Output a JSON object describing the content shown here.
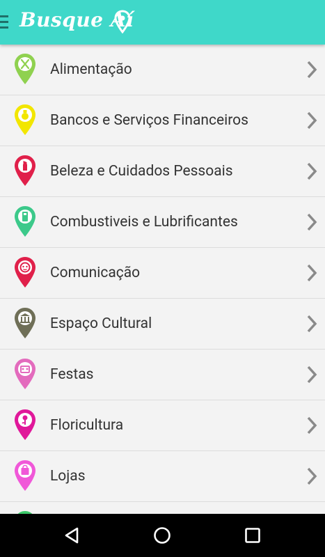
{
  "app_bar": {
    "title": "Busque Aí",
    "icons": [
      "menu-icon",
      "map-pin-icon"
    ],
    "color": "#3fd8c9"
  },
  "categories": [
    {
      "label": "Alimentação",
      "icon": "fork-knife-icon",
      "color": "#8fd14f"
    },
    {
      "label": "Bancos e Serviços Financeiros",
      "icon": "money-bag-icon",
      "color": "#f2e600"
    },
    {
      "label": "Beleza e Cuidados Pessoais",
      "icon": "lipstick-icon",
      "color": "#e0204a"
    },
    {
      "label": "Combustiveis e Lubrificantes",
      "icon": "fuel-pump-icon",
      "color": "#3cc98a"
    },
    {
      "label": "Comunicação",
      "icon": "person-face-icon",
      "color": "#e0204a"
    },
    {
      "label": "Espaço Cultural",
      "icon": "museum-icon",
      "color": "#6f6f57"
    },
    {
      "label": "Festas",
      "icon": "party-icon",
      "color": "#e36bbd"
    },
    {
      "label": "Floricultura",
      "icon": "flower-icon",
      "color": "#e0189a"
    },
    {
      "label": "Lojas",
      "icon": "shopping-bag-icon",
      "color": "#f058d8"
    },
    {
      "label": "",
      "icon": "pin-icon",
      "color": "#3cc96a"
    }
  ],
  "nav_bar": {
    "icons": [
      "back-icon",
      "home-icon",
      "recents-icon"
    ]
  }
}
